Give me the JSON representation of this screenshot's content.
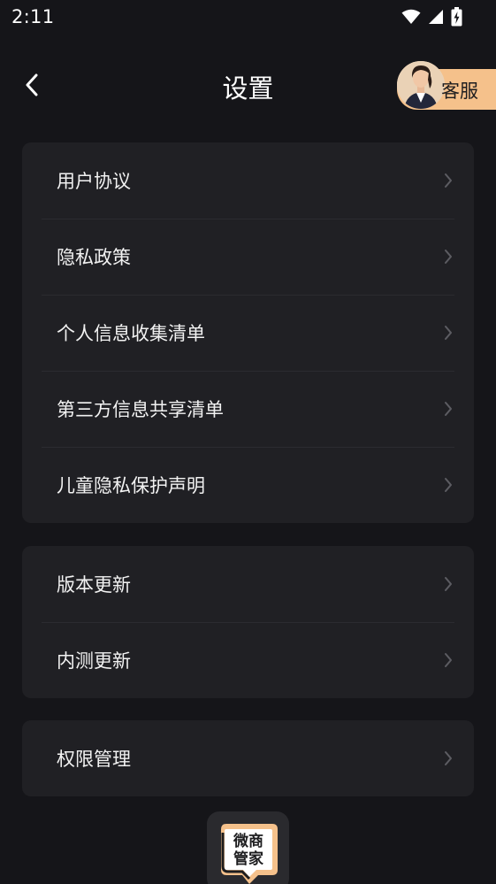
{
  "status_bar": {
    "time": "2:11"
  },
  "header": {
    "title": "设置",
    "customer_service_label": "客服"
  },
  "sections": [
    {
      "items": [
        {
          "label": "用户协议"
        },
        {
          "label": "隐私政策"
        },
        {
          "label": "个人信息收集清单"
        },
        {
          "label": "第三方信息共享清单"
        },
        {
          "label": "儿童隐私保护声明"
        }
      ]
    },
    {
      "items": [
        {
          "label": "版本更新"
        },
        {
          "label": "内测更新"
        }
      ]
    },
    {
      "items": [
        {
          "label": "权限管理"
        }
      ]
    }
  ],
  "logo": {
    "text_line1": "微商",
    "text_line2": "管家"
  },
  "colors": {
    "background": "#151519",
    "card": "#202024",
    "accent": "#f5c18b"
  }
}
